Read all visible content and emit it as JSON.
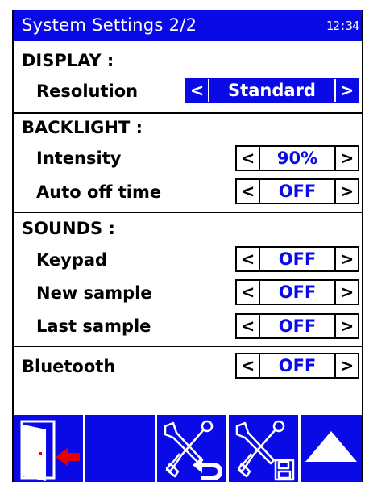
{
  "titlebar": {
    "title": "System Settings 2/2",
    "clock": "12:34"
  },
  "sections": {
    "display": "DISPLAY :",
    "backlight": "BACKLIGHT :",
    "sounds": "SOUNDS :"
  },
  "settings": {
    "resolution": {
      "label": "Resolution",
      "value": "Standard"
    },
    "intensity": {
      "label": "Intensity",
      "value": "90%"
    },
    "auto_off": {
      "label": "Auto off time",
      "value": "OFF"
    },
    "keypad": {
      "label": "Keypad",
      "value": "OFF"
    },
    "new_sample": {
      "label": "New sample",
      "value": "OFF"
    },
    "last_sample": {
      "label": "Last sample",
      "value": "OFF"
    },
    "bluetooth": {
      "label": "Bluetooth",
      "value": "OFF"
    }
  },
  "arrows": {
    "left": "<",
    "right": ">"
  },
  "toolbar": {
    "buttons": [
      {
        "icon": "exit-door-icon"
      },
      {
        "icon": ""
      },
      {
        "icon": "tools-undo-icon"
      },
      {
        "icon": "tools-save-icon"
      },
      {
        "icon": "up-triangle-icon"
      }
    ]
  },
  "colors": {
    "accent": "#0a0ae6",
    "exit_arrow": "#e60000"
  }
}
